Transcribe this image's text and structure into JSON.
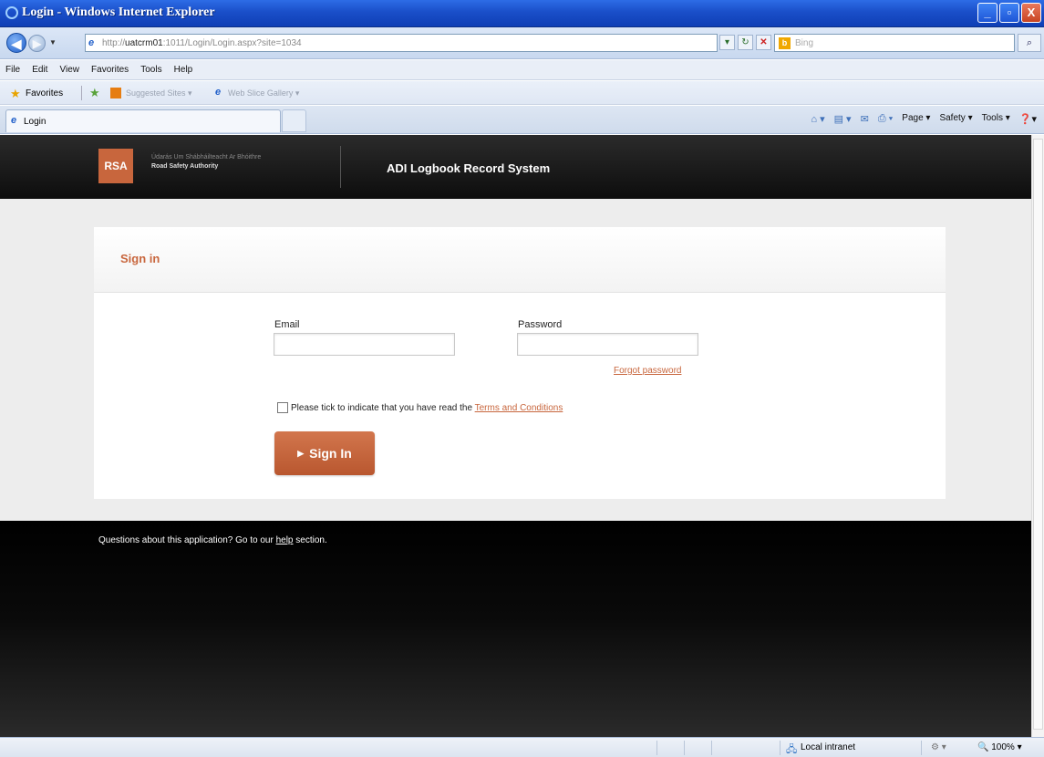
{
  "window": {
    "title": "Login - Windows Internet Explorer",
    "min": "_",
    "max": "▫",
    "close": "X"
  },
  "address": {
    "url_prefix": "http://",
    "url_host": "uatcrm01",
    "url_rest": ":1011/Login/Login.aspx?site=1034",
    "search_placeholder": "Bing"
  },
  "menu": {
    "items": [
      "File",
      "Edit",
      "View",
      "Favorites",
      "Tools",
      "Help"
    ]
  },
  "favorites": {
    "label": "Favorites",
    "suggested": "Suggested Sites ▾",
    "gallery": "Web Slice Gallery ▾"
  },
  "tab": {
    "label": "Login"
  },
  "commandbar": {
    "page": "Page ▾",
    "safety": "Safety ▾",
    "tools": "Tools ▾",
    "help": "▾"
  },
  "header": {
    "logo": "RSA",
    "agency_irish": "Údarás Um Shábháilteacht Ar Bhóithre",
    "agency_english": "Road Safety Authority",
    "system_name": "ADI Logbook Record System"
  },
  "signin": {
    "title": "Sign in",
    "email_label": "Email",
    "email_value": "",
    "password_label": "Password",
    "password_value": "",
    "forgot_link": "Forgot password",
    "terms_text": "Please tick to indicate that you have read the",
    "terms_link": "Terms and Conditions",
    "terms_checked": false,
    "button": "Sign In"
  },
  "footer": {
    "text_before": "Questions about this application? Go to our",
    "help_link": "help",
    "text_after": "section."
  },
  "status": {
    "zone": "Local intranet",
    "protected": "▾",
    "zoom": "100%"
  },
  "colors": {
    "brand": "#c8663d",
    "header_bg": "#1a1a1a",
    "page_bg": "#ededed"
  }
}
